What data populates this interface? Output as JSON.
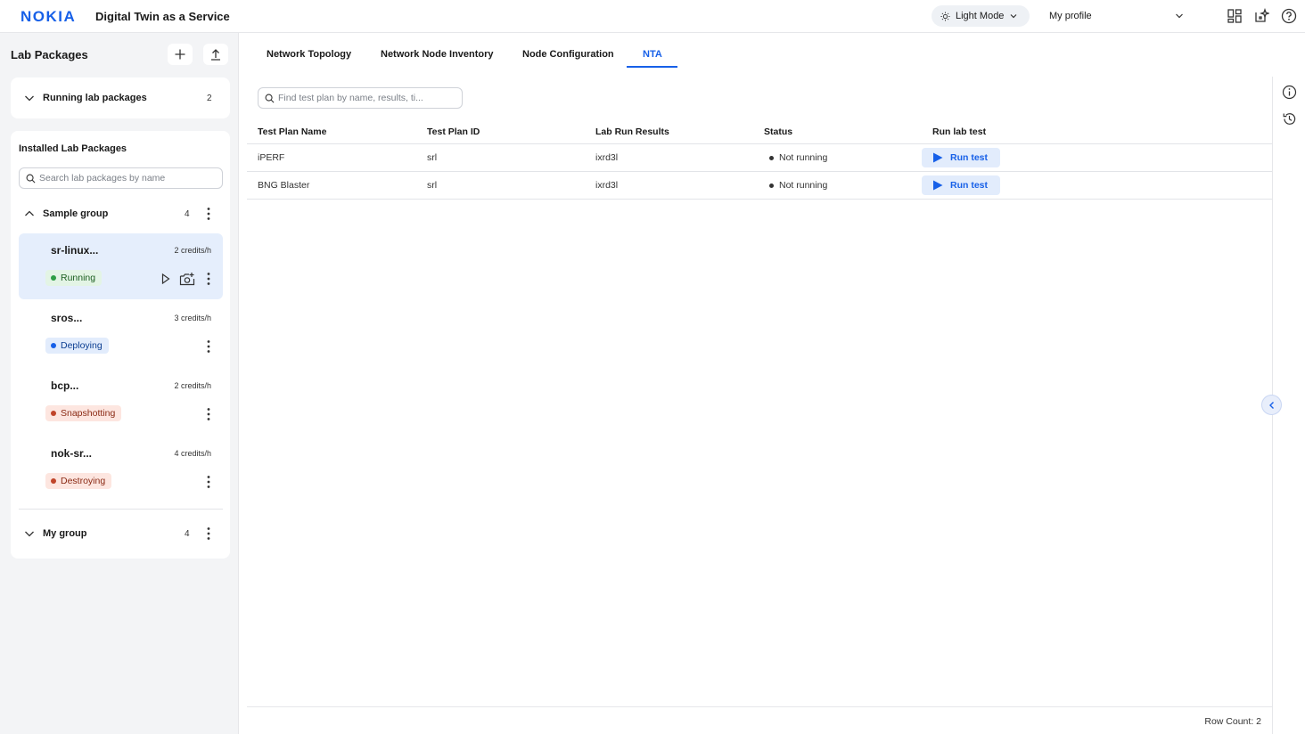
{
  "app": {
    "title": "Digital Twin as a Service",
    "logo_text": "NOKIA"
  },
  "header": {
    "mode_label": "Light Mode",
    "profile_label": "My profile"
  },
  "sidebar": {
    "title": "Lab Packages",
    "running": {
      "label": "Running lab packages",
      "count": "2"
    },
    "installed_title": "Installed Lab Packages",
    "search_placeholder": "Search lab packages by name",
    "groups": [
      {
        "label": "Sample group",
        "count": "4"
      },
      {
        "label": "My group",
        "count": "4"
      }
    ],
    "packages": [
      {
        "name": "sr-linux...",
        "credits": "2 credits/h",
        "status": "Running"
      },
      {
        "name": "sros...",
        "credits": "3 credits/h",
        "status": "Deploying"
      },
      {
        "name": "bcp...",
        "credits": "2 credits/h",
        "status": "Snapshotting"
      },
      {
        "name": "nok-sr...",
        "credits": "4 credits/h",
        "status": "Destroying"
      }
    ]
  },
  "tabs": [
    {
      "label": "Network Topology"
    },
    {
      "label": "Network Node Inventory"
    },
    {
      "label": "Node Configuration"
    },
    {
      "label": "NTA"
    }
  ],
  "main": {
    "search_placeholder": "Find test plan by name, results, ti...",
    "columns": [
      "Test Plan Name",
      "Test Plan ID",
      "Lab Run Results",
      "Status",
      "Run lab test"
    ],
    "rows": [
      {
        "name": "iPERF",
        "id": "srl",
        "results": "ixrd3l",
        "status": "Not running",
        "action": "Run test"
      },
      {
        "name": "BNG Blaster",
        "id": "srl",
        "results": "ixrd3l",
        "status": "Not running",
        "action": "Run test"
      }
    ],
    "row_count": "Row Count: 2"
  },
  "colors": {
    "accent": "#1760e8",
    "sidebar_bg": "#f3f4f6",
    "running": "#2e9e45",
    "deploying": "#1760e8",
    "warning": "#c0452a"
  }
}
